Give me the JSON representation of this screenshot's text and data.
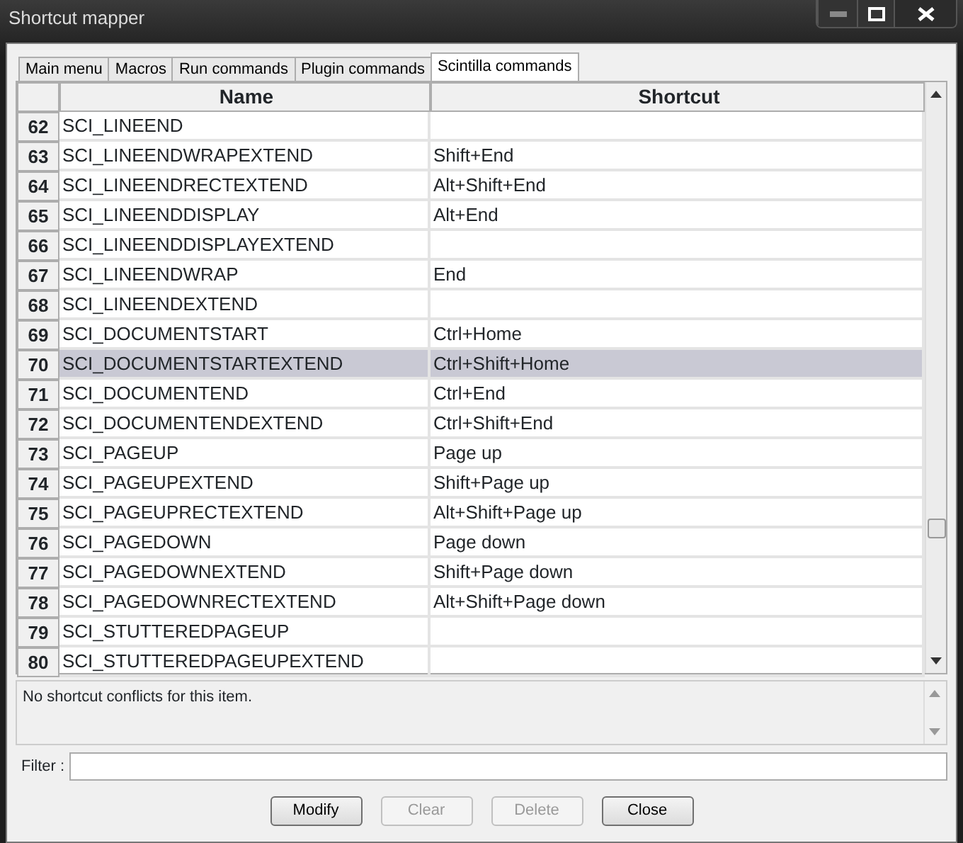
{
  "window": {
    "title": "Shortcut mapper"
  },
  "tabs": [
    {
      "label": "Main menu",
      "selected": false
    },
    {
      "label": "Macros",
      "selected": false
    },
    {
      "label": "Run commands",
      "selected": false
    },
    {
      "label": "Plugin commands",
      "selected": false
    },
    {
      "label": "Scintilla commands",
      "selected": true
    }
  ],
  "table": {
    "columns": [
      "Name",
      "Shortcut"
    ],
    "rows": [
      {
        "number": "62",
        "name": "SCI_LINEEND",
        "shortcut": "",
        "selected": false
      },
      {
        "number": "63",
        "name": "SCI_LINEENDWRAPEXTEND",
        "shortcut": "Shift+End",
        "selected": false
      },
      {
        "number": "64",
        "name": "SCI_LINEENDRECTEXTEND",
        "shortcut": "Alt+Shift+End",
        "selected": false
      },
      {
        "number": "65",
        "name": "SCI_LINEENDDISPLAY",
        "shortcut": "Alt+End",
        "selected": false
      },
      {
        "number": "66",
        "name": "SCI_LINEENDDISPLAYEXTEND",
        "shortcut": "",
        "selected": false
      },
      {
        "number": "67",
        "name": "SCI_LINEENDWRAP",
        "shortcut": "End",
        "selected": false
      },
      {
        "number": "68",
        "name": "SCI_LINEENDEXTEND",
        "shortcut": "",
        "selected": false
      },
      {
        "number": "69",
        "name": "SCI_DOCUMENTSTART",
        "shortcut": "Ctrl+Home",
        "selected": false
      },
      {
        "number": "70",
        "name": "SCI_DOCUMENTSTARTEXTEND",
        "shortcut": "Ctrl+Shift+Home",
        "selected": true
      },
      {
        "number": "71",
        "name": "SCI_DOCUMENTEND",
        "shortcut": "Ctrl+End",
        "selected": false
      },
      {
        "number": "72",
        "name": "SCI_DOCUMENTENDEXTEND",
        "shortcut": "Ctrl+Shift+End",
        "selected": false
      },
      {
        "number": "73",
        "name": "SCI_PAGEUP",
        "shortcut": "Page up",
        "selected": false
      },
      {
        "number": "74",
        "name": "SCI_PAGEUPEXTEND",
        "shortcut": "Shift+Page up",
        "selected": false
      },
      {
        "number": "75",
        "name": "SCI_PAGEUPRECTEXTEND",
        "shortcut": "Alt+Shift+Page up",
        "selected": false
      },
      {
        "number": "76",
        "name": "SCI_PAGEDOWN",
        "shortcut": "Page down",
        "selected": false
      },
      {
        "number": "77",
        "name": "SCI_PAGEDOWNEXTEND",
        "shortcut": "Shift+Page down",
        "selected": false
      },
      {
        "number": "78",
        "name": "SCI_PAGEDOWNRECTEXTEND",
        "shortcut": "Alt+Shift+Page down",
        "selected": false
      },
      {
        "number": "79",
        "name": "SCI_STUTTEREDPAGEUP",
        "shortcut": "",
        "selected": false
      },
      {
        "number": "80",
        "name": "SCI_STUTTEREDPAGEUPEXTEND",
        "shortcut": "",
        "selected": false
      }
    ]
  },
  "conflicts": {
    "text": "No shortcut conflicts for this item."
  },
  "filter": {
    "label": "Filter :"
  },
  "buttons": [
    {
      "label": "Modify",
      "disabled": false
    },
    {
      "label": "Clear",
      "disabled": true
    },
    {
      "label": "Delete",
      "disabled": true
    },
    {
      "label": "Close",
      "disabled": false
    }
  ]
}
